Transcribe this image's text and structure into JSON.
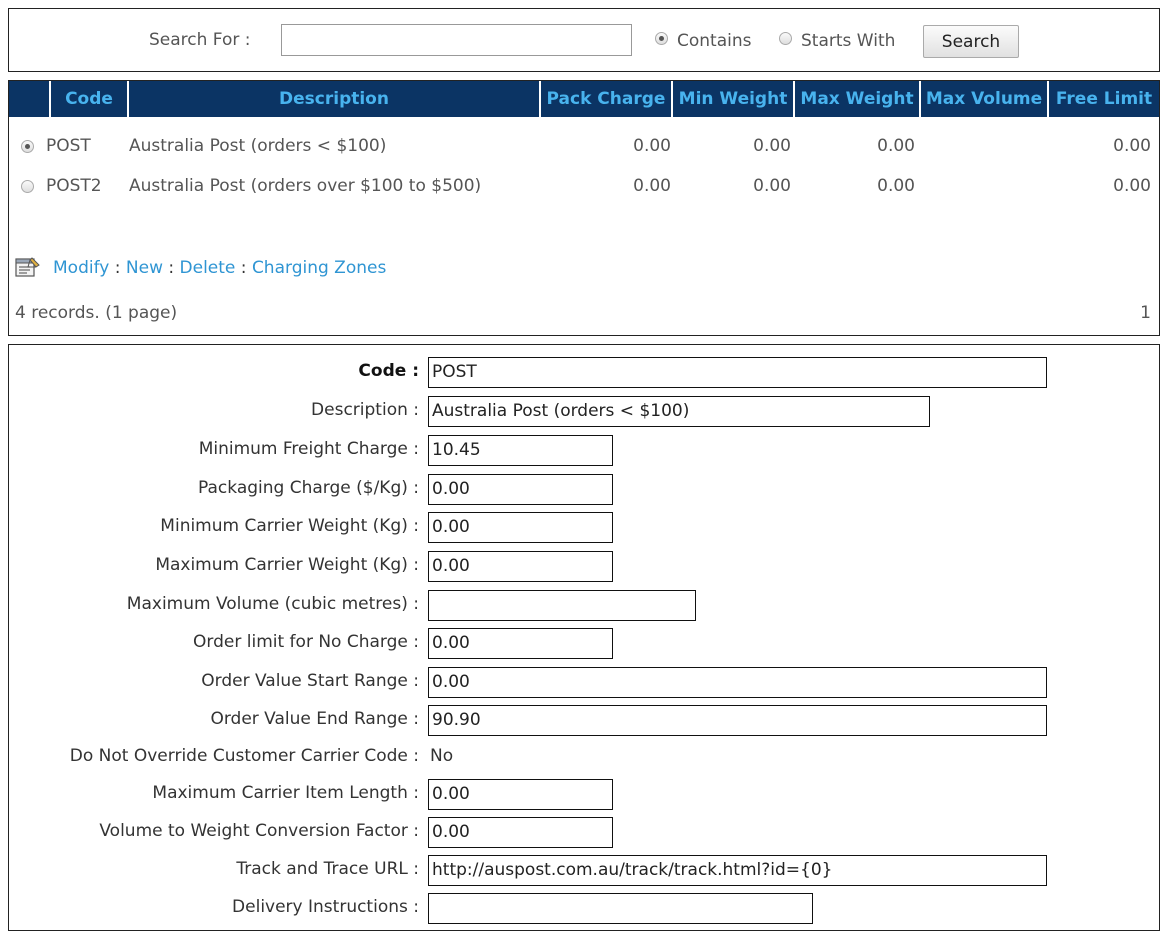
{
  "search": {
    "label": "Search For :",
    "value": "",
    "placeholder": "",
    "options": [
      {
        "label": "Contains",
        "selected": true
      },
      {
        "label": "Starts With",
        "selected": false
      }
    ],
    "button_label": "Search"
  },
  "grid": {
    "columns": [
      "Code",
      "Description",
      "Pack Charge",
      "Min Weight",
      "Max Weight",
      "Max Volume",
      "Free Limit"
    ],
    "rows": [
      {
        "selected": true,
        "code": "POST",
        "description": "Australia Post (orders < $100)",
        "pack_charge": "0.00",
        "min_weight": "0.00",
        "max_weight": "0.00",
        "max_volume": "",
        "free_limit": "0.00"
      },
      {
        "selected": false,
        "code": "POST2",
        "description": "Australia Post (orders over $100 to $500)",
        "pack_charge": "0.00",
        "min_weight": "0.00",
        "max_weight": "0.00",
        "max_volume": "",
        "free_limit": "0.00"
      }
    ],
    "actions": {
      "modify": "Modify",
      "new": "New",
      "delete": "Delete",
      "charging_zones": "Charging Zones",
      "separator": ":"
    },
    "record_count": "4 records. (1 page)",
    "page_number": "1"
  },
  "detail": {
    "fields": [
      {
        "label": "Code :",
        "value": "POST"
      },
      {
        "label": "Description :",
        "value": "Australia Post (orders < $100)"
      },
      {
        "label": "Minimum Freight Charge :",
        "value": "10.45"
      },
      {
        "label": "Packaging Charge ($/Kg) :",
        "value": "0.00"
      },
      {
        "label": "Minimum Carrier Weight (Kg) :",
        "value": "0.00"
      },
      {
        "label": "Maximum Carrier Weight (Kg) :",
        "value": "0.00"
      },
      {
        "label": "Maximum Volume (cubic metres) :",
        "value": ""
      },
      {
        "label": "Order limit for No Charge :",
        "value": "0.00"
      },
      {
        "label": "Order Value Start Range :",
        "value": "0.00"
      },
      {
        "label": "Order Value End Range :",
        "value": "90.90"
      },
      {
        "label": "Do Not Override Customer Carrier Code :",
        "value": "No"
      },
      {
        "label": "Maximum Carrier Item Length :",
        "value": "0.00"
      },
      {
        "label": "Volume to Weight Conversion Factor :",
        "value": "0.00"
      },
      {
        "label": "Track and Trace URL :",
        "value": "http://auspost.com.au/track/track.html?id={0}"
      },
      {
        "label": "Delivery Instructions :",
        "value": ""
      }
    ]
  },
  "colors": {
    "header_bg": "#0b3464",
    "header_text": "#48b3ee",
    "link": "#2f95d3"
  }
}
